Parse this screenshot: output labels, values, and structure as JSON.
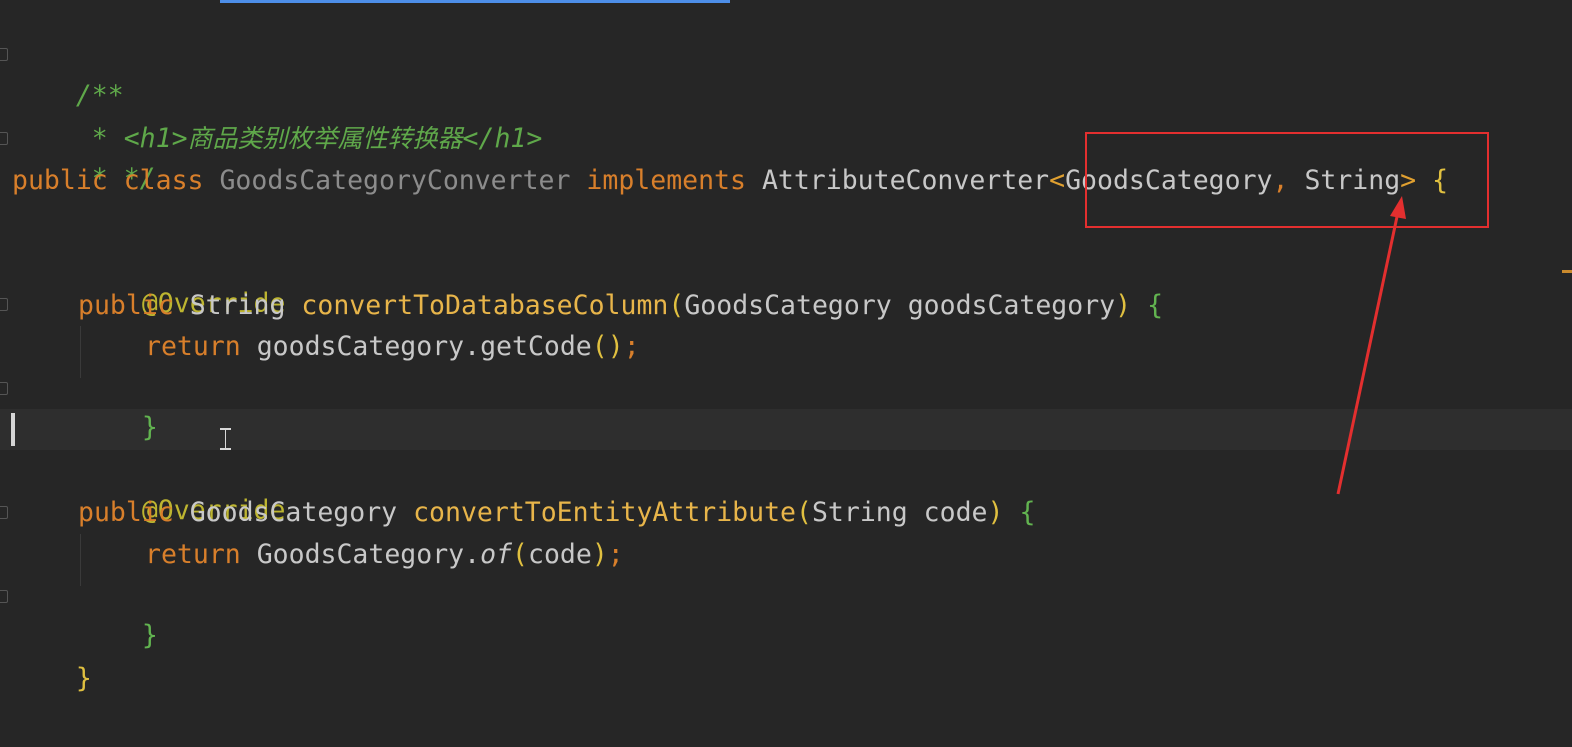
{
  "code": {
    "doc_open": "/**",
    "doc_star": " * ",
    "doc_h1_open": "<h1>",
    "doc_title": "商品类别枚举属性转换器",
    "doc_h1_close": "</h1>",
    "doc_close": " * */",
    "kw_public": "public",
    "kw_class": "class",
    "class_name": "GoodsCategoryConverter",
    "kw_implements": "implements",
    "interface_name": "AttributeConverter",
    "generic_open": "<",
    "generic_type_1": "GoodsCategory",
    "generic_comma": ", ",
    "generic_type_2": "String",
    "generic_close": ">",
    "brace_open": "{",
    "brace_close": "}",
    "annotation": "@Override",
    "m1_return_type": "String",
    "m1_name": "convertToDatabaseColumn",
    "m1_param_type": "GoodsCategory",
    "m1_param_name": "goodsCategory",
    "kw_return": "return",
    "m1_body_obj": "goodsCategory",
    "m1_body_call": ".getCode",
    "m2_return_type": "GoodsCategory",
    "m2_name": "convertToEntityAttribute",
    "m2_param_type": "String",
    "m2_param_name": "code",
    "m2_body_obj": "GoodsCategory",
    "m2_body_dot": ".",
    "m2_body_call": "of",
    "m2_body_arg": "code",
    "paren_open": "(",
    "paren_close": ")",
    "semicolon": ";",
    "space": " "
  },
  "colors": {
    "background": "#262626",
    "keyword": "#d87f2b",
    "comment": "#5fa84a",
    "annotation": "#bdb530",
    "method": "#e8b54a",
    "highlight_box": "#e32f2f",
    "arrow": "#e32f2f"
  },
  "icons": {
    "cursor": "text-ibeam-cursor-icon",
    "fold": "fold-marker-icon",
    "arrow": "red-arrow-annotation"
  }
}
